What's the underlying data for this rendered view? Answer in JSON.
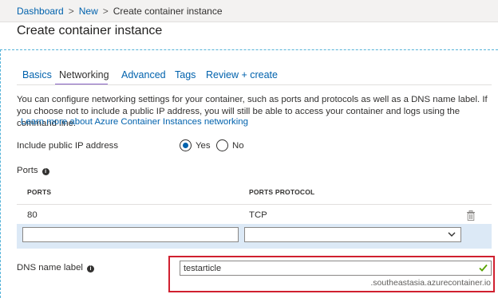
{
  "breadcrumb": {
    "items": [
      {
        "label": "Dashboard"
      },
      {
        "label": "New"
      },
      {
        "label": "Create container instance"
      }
    ],
    "separator": ">"
  },
  "page": {
    "title": "Create container instance"
  },
  "tabs": [
    {
      "label": "Basics",
      "active": false
    },
    {
      "label": "Networking",
      "active": true
    },
    {
      "label": "Advanced",
      "active": false
    },
    {
      "label": "Tags",
      "active": false
    },
    {
      "label": "Review + create",
      "active": false
    }
  ],
  "description": {
    "text": "You can configure networking settings for your container, such as ports and protocols as well as a DNS name label. If you choose not to include a public IP address, you will still be able to access your container and logs using the command line.",
    "link": "Learn more about Azure Container Instances networking"
  },
  "public_ip": {
    "label": "Include public IP address",
    "options": [
      {
        "label": "Yes",
        "checked": true
      },
      {
        "label": "No",
        "checked": false
      }
    ]
  },
  "ports": {
    "label": "Ports",
    "columns": [
      "PORTS",
      "PORTS PROTOCOL"
    ],
    "rows": [
      {
        "port": "80",
        "protocol": "TCP"
      }
    ],
    "new_row": {
      "port_value": "",
      "protocol_value": ""
    }
  },
  "dns": {
    "label": "DNS name label",
    "value": "testarticle",
    "suffix": ".southeastasia.azurecontainer.io"
  },
  "colors": {
    "link": "#0062ad",
    "tab_underline": "#8661c5",
    "highlight_border": "#d0202f",
    "new_row_bg": "#dce9f6",
    "valid_check": "#57a300"
  },
  "icons": {
    "info": "info-icon",
    "delete": "trash-icon",
    "dropdown": "chevron-down-icon",
    "valid": "checkmark-icon"
  }
}
